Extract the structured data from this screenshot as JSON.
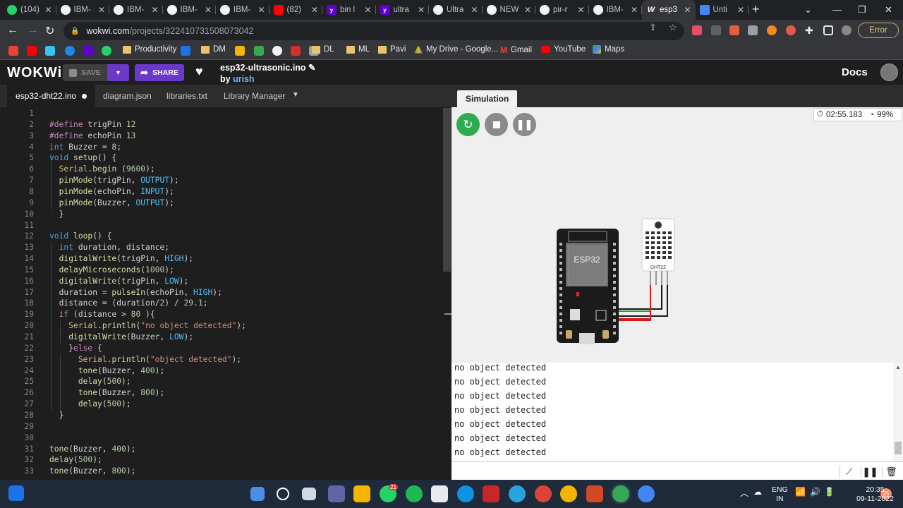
{
  "browser": {
    "tabs": [
      {
        "icon": "whatsapp",
        "label": "(104)",
        "active": false
      },
      {
        "icon": "github",
        "label": "IBM-",
        "active": false
      },
      {
        "icon": "github",
        "label": "IBM-",
        "active": false
      },
      {
        "icon": "github",
        "label": "IBM-",
        "active": false
      },
      {
        "icon": "github",
        "label": "IBM-",
        "active": false
      },
      {
        "icon": "youtube",
        "label": "(82)",
        "active": false
      },
      {
        "icon": "yahoo",
        "label": "bin l",
        "active": false
      },
      {
        "icon": "yahoo",
        "label": "ultra",
        "active": false
      },
      {
        "icon": "github",
        "label": "Ultra",
        "active": false
      },
      {
        "icon": "github",
        "label": "NEW",
        "active": false
      },
      {
        "icon": "github",
        "label": "pir-r",
        "active": false
      },
      {
        "icon": "github",
        "label": "IBM-",
        "active": false
      },
      {
        "icon": "wokwi",
        "label": "esp3",
        "active": true
      },
      {
        "icon": "docs",
        "label": "Unti",
        "active": false
      }
    ],
    "close_glyph": "✕",
    "new_tab": "+",
    "url_host": "wokwi.com",
    "url_path": "/projects/322410731508073042",
    "error_label": "Error",
    "bookmarks": [
      {
        "label": "Productivity",
        "icon": "folder"
      },
      {
        "label": "DM",
        "icon": "folder"
      },
      {
        "label": "DL",
        "icon": "folder"
      },
      {
        "label": "ML",
        "icon": "folder"
      },
      {
        "label": "Pavi",
        "icon": "folder"
      },
      {
        "label": "My Drive - Google...",
        "icon": "drive-icon"
      },
      {
        "label": "Gmail",
        "icon": "gmail-icon"
      },
      {
        "label": "YouTube",
        "icon": "youtube-icon"
      },
      {
        "label": "Maps",
        "icon": "maps-icon"
      }
    ]
  },
  "wokwi": {
    "logo": "WOKWi",
    "save_label": "SAVE",
    "share_label": "SHARE",
    "project_title": "esp32-ultrasonic.ino",
    "by_label": "by",
    "author": "urish",
    "docs_label": "Docs",
    "editor_tabs": [
      "esp32-dht22.ino",
      "diagram.json",
      "libraries.txt",
      "Library Manager"
    ],
    "sim_tab": "Simulation",
    "timer": "02:55.183",
    "speed": "99%",
    "esp32_label": "ESP32",
    "dht_label": "DHT22",
    "colors": {
      "accent": "#6b38c9",
      "restart": "#2eaa4f",
      "wire_green": "#2e9e3b",
      "wire_red": "#d31818"
    }
  },
  "code": [
    "",
    "#define trigPin 12",
    "#define echoPin 13",
    "int Buzzer = 8;",
    "void setup() {",
    "  Serial.begin (9600);",
    "  pinMode(trigPin, OUTPUT);",
    "  pinMode(echoPin, INPUT);",
    "  pinMode(Buzzer, OUTPUT);",
    "  }",
    "",
    "void loop() {",
    "  int duration, distance;",
    "  digitalWrite(trigPin, HIGH);",
    "  delayMicroseconds(1000);",
    "  digitalWrite(trigPin, LOW);",
    "  duration = pulseIn(echoPin, HIGH);",
    "  distance = (duration/2) / 29.1;",
    "  if (distance > 80 ){",
    "    Serial.println(\"no object detected\");",
    "    digitalWrite(Buzzer, LOW);",
    "    }else {",
    "      Serial.println(\"object detected\");",
    "      tone(Buzzer, 400);",
    "      delay(500);",
    "      tone(Buzzer, 800);",
    "      delay(500);",
    "  }",
    "",
    "",
    "tone(Buzzer, 400);",
    "delay(500);",
    "tone(Buzzer, 800);"
  ],
  "serial_output": [
    "no object detected",
    "no object detected",
    "no object detected",
    "no object detected",
    "no object detected",
    "no object detected",
    "no object detected"
  ],
  "taskbar": {
    "lang": "ENG",
    "region": "IN",
    "time": "20:35",
    "date": "09-11-2022",
    "notif_count": "25",
    "whatsapp_badge": "21"
  }
}
